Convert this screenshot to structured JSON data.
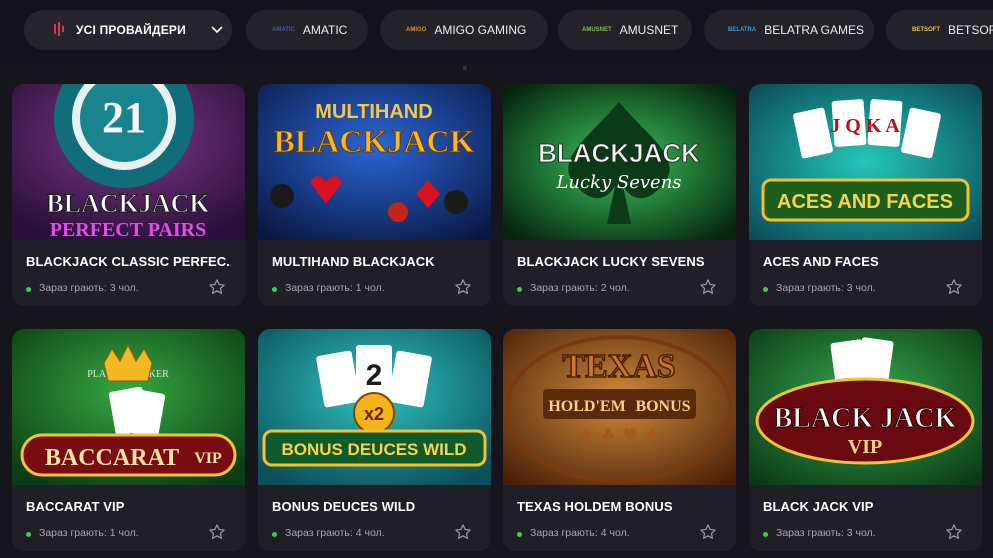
{
  "providers_bar": {
    "all_label": "УСІ ПРОВАЙДЕРИ",
    "chips": [
      {
        "label": "AMATIC",
        "logo_text": "AMATIC",
        "logo_color": "#4a56a8"
      },
      {
        "label": "AMIGO GAMING",
        "logo_text": "AMIGO",
        "logo_color": "#e58a1f"
      },
      {
        "label": "AMUSNET",
        "logo_text": "AMUSNET",
        "logo_color": "#7cc242"
      },
      {
        "label": "BELATRA GAMES",
        "logo_text": "BELATRA",
        "logo_color": "#2f9ddb"
      },
      {
        "label": "BETSOFT",
        "logo_text": "BETSOFT",
        "logo_color": "#f2c230"
      }
    ]
  },
  "games": [
    {
      "title": "BLACKJACK CLASSIC PERFEC...",
      "online": "Зараз грають: 3 чол.",
      "art_top": "21",
      "art_main": "BLACKJACK",
      "art_sub": "PERFECT PAIRS",
      "bg1": "#7d3a8a",
      "bg2": "#2b0f3a"
    },
    {
      "title": "MULTIHAND BLACKJACK",
      "online": "Зараз грають: 1 чол.",
      "art_top": "MULTIHAND",
      "art_main": "BLACKJACK",
      "art_sub": "",
      "bg1": "#1f4fa8",
      "bg2": "#08163f"
    },
    {
      "title": "BLACKJACK LUCKY SEVENS",
      "online": "Зараз грають: 2 чол.",
      "art_top": "",
      "art_main": "BLACKJACK",
      "art_sub": "Lucky Sevens",
      "bg1": "#2fa64a",
      "bg2": "#06250f"
    },
    {
      "title": "ACES AND FACES",
      "online": "Зараз грають: 3 чол.",
      "art_top": "J Q K A",
      "art_main": "ACES AND FACES",
      "art_sub": "",
      "bg1": "#1db3a6",
      "bg2": "#0a4a57"
    },
    {
      "title": "BACCARAT VIP",
      "online": "Зараз грають: 1 чол.",
      "art_top": "PLAYER  BANKER",
      "art_main": "BACCARAT",
      "art_sub": "VIP",
      "bg1": "#2f9b3a",
      "bg2": "#0b3d12"
    },
    {
      "title": "BONUS DEUCES WILD",
      "online": "Зараз грають: 4 чол.",
      "art_top": "x2",
      "art_main": "BONUS DEUCES WILD",
      "art_sub": "",
      "bg1": "#26b6b6",
      "bg2": "#0b4f5a"
    },
    {
      "title": "TEXAS HOLDEM BONUS",
      "online": "Зараз грають: 4 чол.",
      "art_top": "TEXAS",
      "art_main": "HOLD'EM",
      "art_sub": "BONUS",
      "bg1": "#c47a2c",
      "bg2": "#4a2008"
    },
    {
      "title": "BLACK JACK VIP",
      "online": "Зараз грають: 3 чол.",
      "art_top": "",
      "art_main": "BLACK JACK",
      "art_sub": "VIP",
      "bg1": "#2e9a46",
      "bg2": "#0c3a14"
    }
  ]
}
